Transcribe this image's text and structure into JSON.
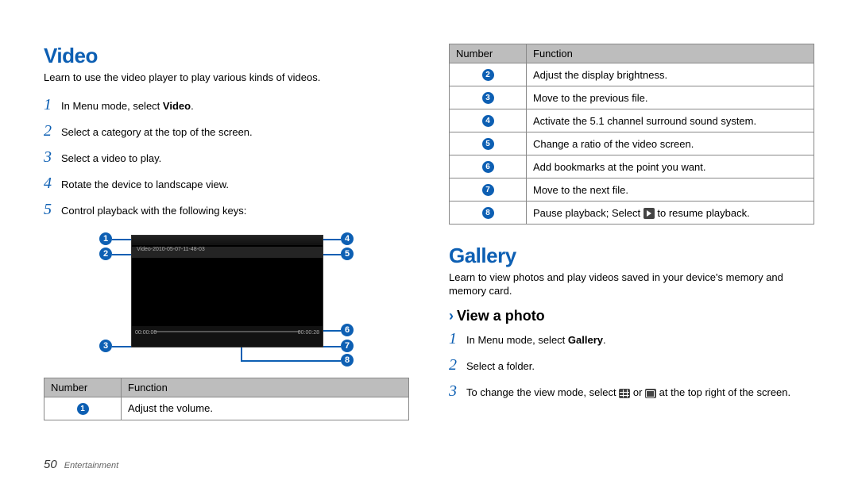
{
  "left": {
    "heading": "Video",
    "intro": "Learn to use the video player to play various kinds of videos.",
    "steps": [
      {
        "num": "1",
        "pre": "In Menu mode, select ",
        "bold": "Video",
        "post": "."
      },
      {
        "num": "2",
        "pre": "Select a category at the top of the screen.",
        "bold": "",
        "post": ""
      },
      {
        "num": "3",
        "pre": "Select a video to play.",
        "bold": "",
        "post": ""
      },
      {
        "num": "4",
        "pre": "Rotate the device to landscape view.",
        "bold": "",
        "post": ""
      },
      {
        "num": "5",
        "pre": "Control playback with the following keys:",
        "bold": "",
        "post": ""
      }
    ],
    "figure_filename": "Video-2010-05-07-11-48-03",
    "figure_time_left": "00:00:00",
    "figure_time_right": "00:00:28",
    "callout_labels": [
      "1",
      "2",
      "3",
      "4",
      "5",
      "6",
      "7",
      "8"
    ],
    "table_headers": {
      "num": "Number",
      "func": "Function"
    },
    "table_rows": [
      {
        "n": "1",
        "f": "Adjust the volume."
      }
    ]
  },
  "right": {
    "table_headers": {
      "num": "Number",
      "func": "Function"
    },
    "table_rows": [
      {
        "n": "2",
        "f": "Adjust the display brightness."
      },
      {
        "n": "3",
        "f": "Move to the previous file."
      },
      {
        "n": "4",
        "f": "Activate the 5.1 channel surround sound system."
      },
      {
        "n": "5",
        "f": "Change a ratio of the video screen."
      },
      {
        "n": "6",
        "f": "Add bookmarks at the point you want."
      },
      {
        "n": "7",
        "f": "Move to the next file."
      },
      {
        "n": "8",
        "f_pre": "Pause playback; Select ",
        "f_post": " to resume playback."
      }
    ],
    "gallery_heading": "Gallery",
    "gallery_intro": "Learn to view photos and play videos saved in your device's memory and memory card.",
    "sub_heading_marker": "›",
    "sub_heading": "View a photo",
    "gallery_steps": [
      {
        "num": "1",
        "pre": "In Menu mode, select ",
        "bold": "Gallery",
        "post": "."
      },
      {
        "num": "2",
        "pre": "Select a folder.",
        "bold": "",
        "post": ""
      },
      {
        "num": "3",
        "pre": "To change the view mode, select ",
        "mid": " or ",
        "post": " at the top right of the screen."
      }
    ]
  },
  "footer": {
    "page": "50",
    "chapter": "Entertainment"
  }
}
